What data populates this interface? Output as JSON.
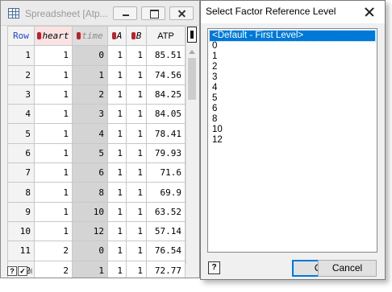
{
  "spreadsheet": {
    "title": "Spreadsheet [Atp...",
    "columns": {
      "row": "Row",
      "heart": "heart",
      "time": "time",
      "a": "A",
      "b": "B",
      "atp": "ATP"
    },
    "rows": [
      {
        "row": "1",
        "heart": "1",
        "time": "0",
        "a": "1",
        "b": "1",
        "atp": "85.51"
      },
      {
        "row": "2",
        "heart": "1",
        "time": "1",
        "a": "1",
        "b": "1",
        "atp": "74.56"
      },
      {
        "row": "3",
        "heart": "1",
        "time": "2",
        "a": "1",
        "b": "1",
        "atp": "84.25"
      },
      {
        "row": "4",
        "heart": "1",
        "time": "3",
        "a": "1",
        "b": "1",
        "atp": "84.05"
      },
      {
        "row": "5",
        "heart": "1",
        "time": "4",
        "a": "1",
        "b": "1",
        "atp": "78.41"
      },
      {
        "row": "6",
        "heart": "1",
        "time": "5",
        "a": "1",
        "b": "1",
        "atp": "79.93"
      },
      {
        "row": "7",
        "heart": "1",
        "time": "6",
        "a": "1",
        "b": "1",
        "atp": "71.6"
      },
      {
        "row": "8",
        "heart": "1",
        "time": "8",
        "a": "1",
        "b": "1",
        "atp": "69.9"
      },
      {
        "row": "9",
        "heart": "1",
        "time": "10",
        "a": "1",
        "b": "1",
        "atp": "63.52"
      },
      {
        "row": "10",
        "heart": "1",
        "time": "12",
        "a": "1",
        "b": "1",
        "atp": "57.14"
      },
      {
        "row": "11",
        "heart": "2",
        "time": "0",
        "a": "1",
        "b": "1",
        "atp": "76.54"
      },
      {
        "row": "12",
        "heart": "2",
        "time": "1",
        "a": "1",
        "b": "1",
        "atp": "72.77"
      }
    ],
    "icons": {
      "app": "spreadsheet-icon",
      "minimize": "minimize-icon",
      "maximize": "maximize-icon",
      "close": "close-icon",
      "help": "help-icon",
      "check": "checkmark-icon"
    },
    "help_label": "?",
    "check_label": "✓"
  },
  "dialog": {
    "title": "Select Factor Reference Level",
    "levels": [
      "<Default - First Level>",
      "0",
      "1",
      "2",
      "3",
      "4",
      "5",
      "6",
      "8",
      "10",
      "12"
    ],
    "selected_index": 0,
    "help_label": "?",
    "ok_label": "OK",
    "cancel_label": "Cancel"
  },
  "colors": {
    "selection": "#0078d7",
    "row_header_text": "#2244cc",
    "heart_header_bg": "#fbe3e3",
    "time_column_bg": "#d4d4d4",
    "warning_mark": "#c0202a"
  }
}
